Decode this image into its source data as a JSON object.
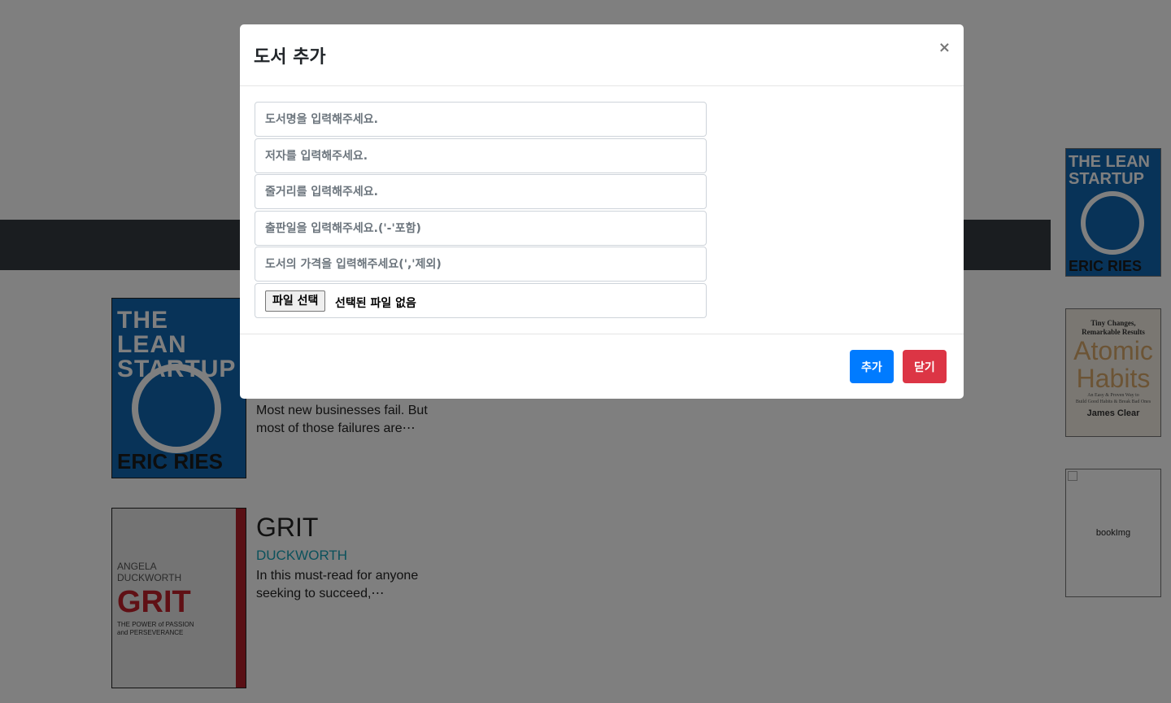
{
  "modal": {
    "title": "도서 추가",
    "close_symbol": "×",
    "fields": {
      "title_placeholder": "도서명을 입력해주세요.",
      "author_placeholder": "저자를 입력해주세요.",
      "summary_placeholder": "줄거리를 입력해주세요.",
      "date_placeholder": "출판일을 입력해주세요.('-'포함)",
      "price_placeholder": "도서의 가격을 입력해주세요(','제외)"
    },
    "file": {
      "button_label": "파일 선택",
      "status": "선택된 파일 없음"
    },
    "buttons": {
      "add_label": "추가",
      "close_label": "닫기"
    },
    "colors": {
      "add": "#007bff",
      "close": "#dc3545"
    }
  },
  "books": [
    {
      "cover": {
        "line1": "THE LEAN",
        "line2": "STARTUP",
        "author_line": "ERIC RIES"
      },
      "description": "Most new businesses fail. But most of those failures are⋯"
    },
    {
      "cover": {
        "name1": "ANGELA",
        "name2": "DUCKWORTH",
        "big": "GRIT",
        "sub1": "THE POWER of PASSION",
        "sub2": "and PERSEVERANCE"
      },
      "title": "GRIT",
      "author": "DUCKWORTH",
      "description": "In this must-read for anyone seeking to succeed,⋯"
    }
  ],
  "side_cards": [
    {
      "line1": "THE LEAN",
      "line2": "STARTUP",
      "author_line": "ERIC RIES"
    },
    {
      "top1": "Tiny Changes,",
      "top2": "Remarkable Results",
      "big1": "Atomic",
      "big2": "Habits",
      "small1": "An Easy & Proven Way to",
      "small2": "Build Good Habits & Break Bad Ones",
      "author_line": "James Clear"
    },
    {
      "alt": "bookImg"
    }
  ]
}
